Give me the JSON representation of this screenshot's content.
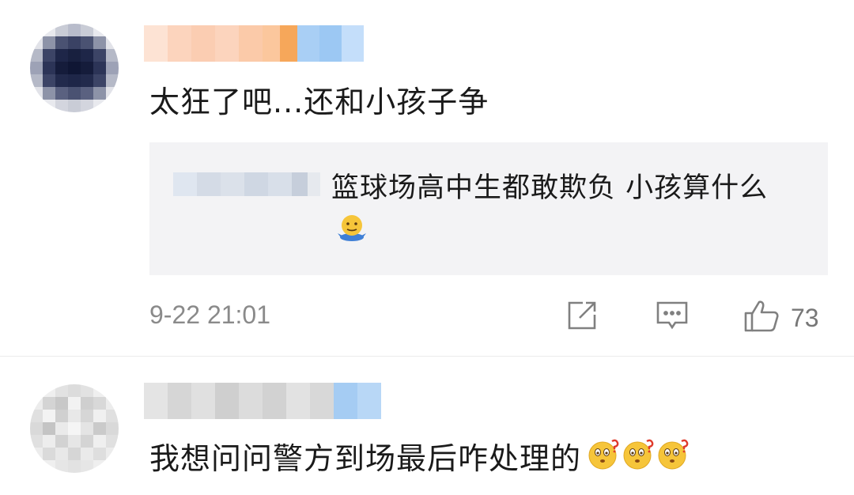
{
  "comments": [
    {
      "text": "太狂了吧...还和小孩子争",
      "reply": {
        "text": "篮球场高中生都敢欺负  小孩算什么"
      },
      "timestamp": "9-22 21:01",
      "likes": "73"
    },
    {
      "text": "我想问问警方到场最后咋处理的"
    }
  ],
  "icons": {
    "share": "share-icon",
    "comment": "comment-icon",
    "like": "thumbs-up-icon"
  },
  "colors": {
    "background": "#ffffff",
    "reply_background": "#f3f3f5",
    "meta_text": "#8a8a8a"
  }
}
